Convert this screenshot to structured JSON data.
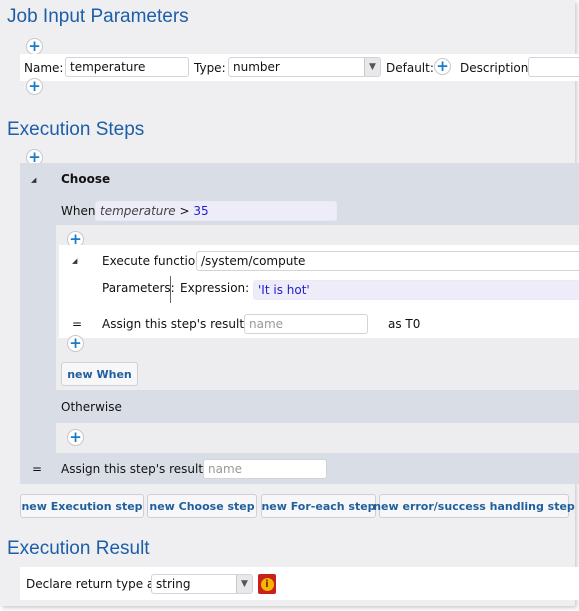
{
  "job_input": {
    "title": "Job Input Parameters",
    "name_label": "Name:",
    "name_value": "temperature",
    "type_label": "Type:",
    "type_value": "number",
    "default_label": "Default:",
    "description_label": "Description:",
    "description_value": ""
  },
  "execution_steps": {
    "title": "Execution Steps",
    "choose": {
      "label": "Choose",
      "when_label": "When",
      "when_var": "temperature",
      "when_op": " > ",
      "when_num": "35",
      "execute_label": "Execute function",
      "function_value": "/system/compute",
      "parameters_label": "Parameters:",
      "expression_label": "Expression:",
      "expression_value": "'It is hot'",
      "assign_eq": "=",
      "assign_label": "Assign this step's result to",
      "assign_placeholder": "name",
      "as_label": "as T0",
      "new_when": "new When",
      "otherwise_label": "Otherwise"
    },
    "assign_eq": "=",
    "assign_label": "Assign this step's result to",
    "assign_placeholder": "name",
    "buttons": [
      "new Execution step",
      "new Choose step",
      "new For-each step",
      "new error/success handling step"
    ]
  },
  "execution_result": {
    "title": "Execution Result",
    "declare_label": "Declare return type as:",
    "return_type": "string",
    "info_icon": "info-icon",
    "info_color": "#c8201c"
  },
  "colors": {
    "accent": "#1d5ea6",
    "plus": "#1a7bc8",
    "choose_bg": "#d9dde6",
    "expression_bg": "#efecf9"
  }
}
